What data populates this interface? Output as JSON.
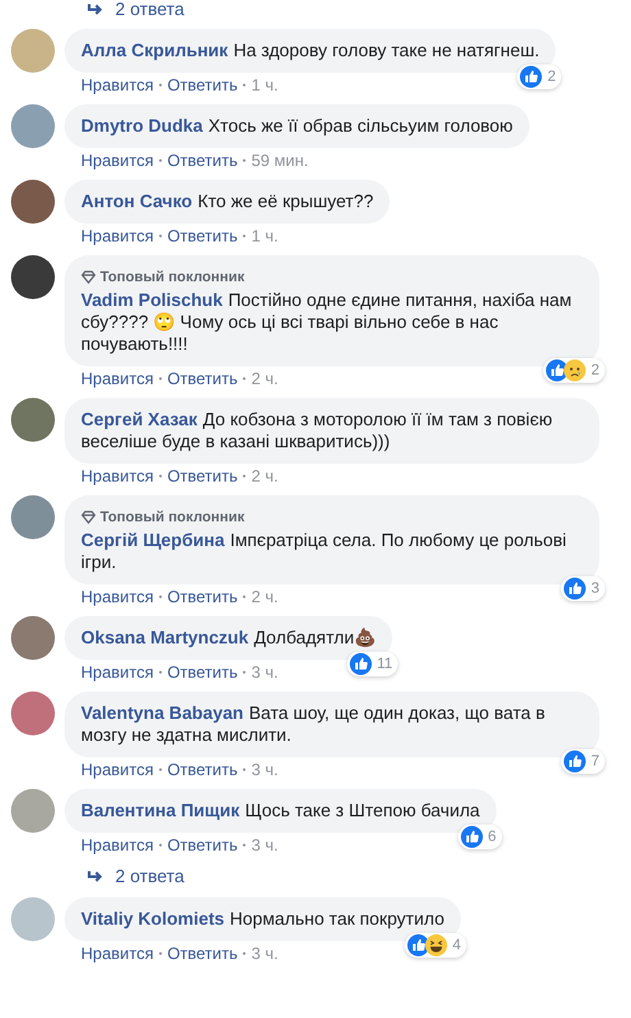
{
  "top_replies_link": {
    "label": "2 ответа"
  },
  "comments": [
    {
      "author": "Алла Скрильник",
      "text": "На здорову голову таке не натягнеш.",
      "reactions": [
        {
          "kind": "like"
        }
      ],
      "reaction_count": "2",
      "actions": [
        "Нравится",
        "Ответить"
      ],
      "time": "1 ч."
    },
    {
      "author": "Dmytro Dudka",
      "text": "Хтось же її обрав сільсьуим головою",
      "actions": [
        "Нравится",
        "Ответить"
      ],
      "time": "59 мин."
    },
    {
      "author": "Антон Сачко",
      "text": "Кто же её крышует??",
      "actions": [
        "Нравится",
        "Ответить"
      ],
      "time": "1 ч."
    },
    {
      "author": "Vadim Polischuk",
      "badge": "Топовый поклонник",
      "text": "Постійно одне єдине питання, нахіба нам сбу???? 🙄 Чому ось ці всі тварі вільно себе в нас почувають!!!!",
      "reactions": [
        {
          "kind": "like"
        },
        {
          "kind": "sad"
        }
      ],
      "reaction_count": "2",
      "actions": [
        "Нравится",
        "Ответить"
      ],
      "time": "2 ч."
    },
    {
      "author": "Сергей Хазак",
      "text": "До кобзона з моторолою її їм там з повією веселіше буде в казані шкваритись)))",
      "actions": [
        "Нравится",
        "Ответить"
      ],
      "time": "2 ч."
    },
    {
      "author": "Сергій Щербина",
      "badge": "Топовый поклонник",
      "text": "Імпєратріца села. По любому це рольові ігри.",
      "reactions": [
        {
          "kind": "like"
        }
      ],
      "reaction_count": "3",
      "actions": [
        "Нравится",
        "Ответить"
      ],
      "time": "2 ч."
    },
    {
      "author": "Oksana Martynczuk",
      "text": "Долбадятли💩",
      "reactions": [
        {
          "kind": "like"
        }
      ],
      "reaction_count": "11",
      "actions": [
        "Нравится",
        "Ответить"
      ],
      "time": "3 ч."
    },
    {
      "author": "Valentyna Babayan",
      "text": "Вата шоу, ще один доказ, що вата в мозгу не здатна мислити.",
      "reactions": [
        {
          "kind": "like"
        }
      ],
      "reaction_count": "7",
      "actions": [
        "Нравится",
        "Ответить"
      ],
      "time": "3 ч."
    },
    {
      "author": "Валентина Пищик",
      "text": "Щось таке з Штепою бачила",
      "reactions": [
        {
          "kind": "like"
        }
      ],
      "reaction_count": "6",
      "actions": [
        "Нравится",
        "Ответить"
      ],
      "time": "3 ч.",
      "replies_link": "2 ответа"
    },
    {
      "author": "Vitaliy Kolomiets",
      "text": "Нормально так покрутило",
      "reactions": [
        {
          "kind": "like"
        },
        {
          "kind": "haha"
        }
      ],
      "reaction_count": "4",
      "actions": [
        "Нравится",
        "Ответить"
      ],
      "time": "3 ч."
    }
  ]
}
